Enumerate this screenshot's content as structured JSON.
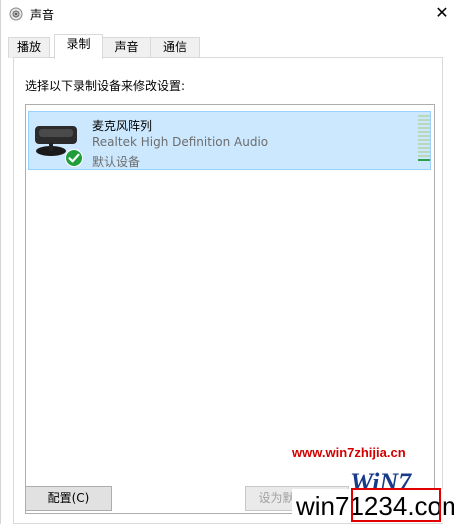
{
  "window": {
    "title": "声音",
    "close_glyph": "✕"
  },
  "tabs": [
    {
      "label": "播放"
    },
    {
      "label": "录制",
      "active": true
    },
    {
      "label": "声音"
    },
    {
      "label": "通信"
    }
  ],
  "panel": {
    "instruction": "选择以下录制设备来修改设置:",
    "devices": [
      {
        "name": "麦克风阵列",
        "description": "Realtek High Definition Audio",
        "status": "默认设备",
        "icon": "microphone-array-icon",
        "badge": "default-check-icon",
        "selected": true,
        "level": 0.05
      }
    ]
  },
  "buttons": {
    "configure_label": "配置(C)",
    "set_default_label": "设为默认值(S)"
  },
  "watermark": {
    "url": "www.win7zhijia.cn",
    "logo": "WiN7",
    "number": "win71234.com"
  },
  "colors": {
    "selection_bg": "#cce8ff",
    "selection_border": "#99d1ff",
    "check_green": "#1f9e3a",
    "meter_green": "#2e9e48"
  }
}
